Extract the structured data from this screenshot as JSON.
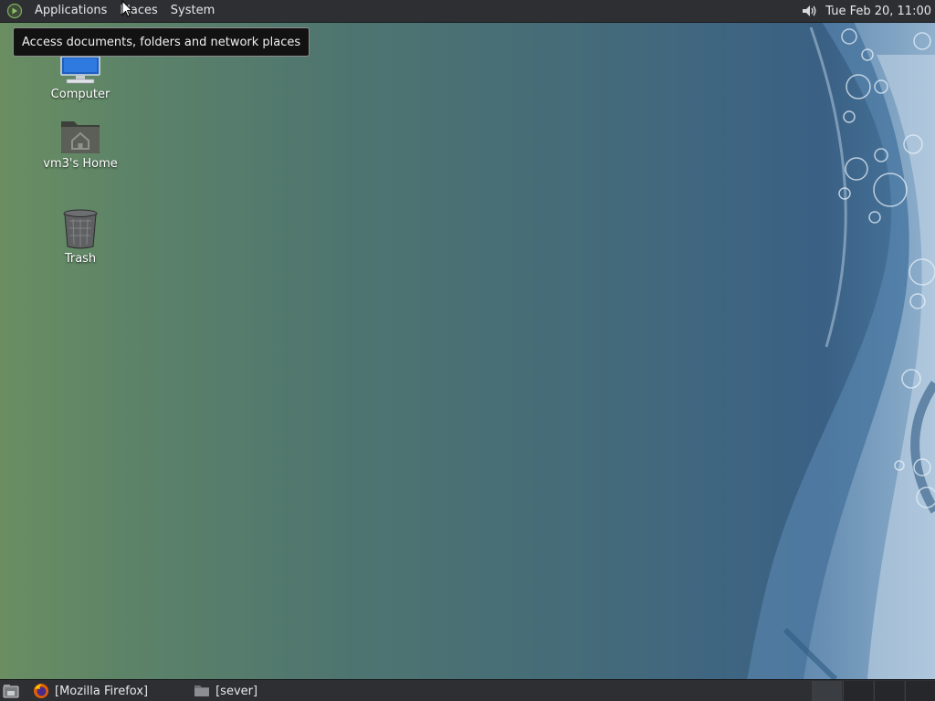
{
  "top_panel": {
    "menus": [
      "Applications",
      "Places",
      "System"
    ],
    "clock": "Tue Feb 20, 11:00"
  },
  "tooltip": {
    "text": "Access documents, folders and network places"
  },
  "desktop_icons": [
    {
      "label": "Computer",
      "icon": "computer-icon"
    },
    {
      "label": "vm3's Home",
      "icon": "home-folder-icon"
    },
    {
      "label": "Trash",
      "icon": "trash-icon"
    }
  ],
  "taskbar": {
    "tasks": [
      {
        "label": "[Mozilla Firefox]",
        "icon": "firefox-icon"
      },
      {
        "label": "[sever]",
        "icon": "folder-icon"
      }
    ]
  },
  "colors": {
    "panel_bg": "#2d2f33",
    "tooltip_bg": "#121212",
    "wallpaper_left": "#6a8e62",
    "wallpaper_right": "#3a6084"
  }
}
